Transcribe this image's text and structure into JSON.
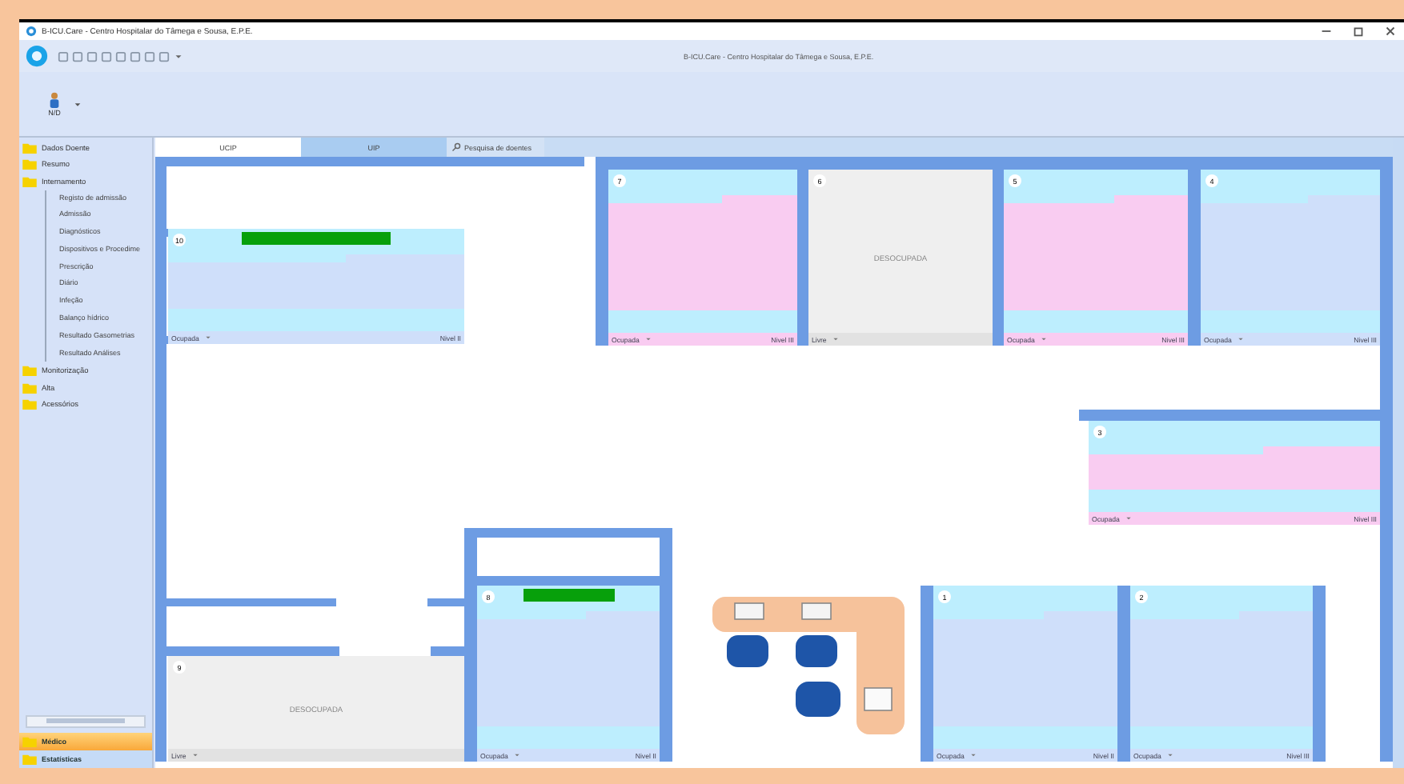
{
  "window": {
    "title": "B-ICU.Care - Centro Hospitalar do Tâmega e Sousa, E.P.E.",
    "ribbon_title": "B-ICU.Care - Centro Hospitalar do Tâmega e Sousa, E.P.E."
  },
  "user": {
    "label": "N/D"
  },
  "sidebar": {
    "items": [
      {
        "label": "Dados Doente"
      },
      {
        "label": "Resumo"
      },
      {
        "label": "Internamento",
        "children": [
          {
            "label": "Registo de admissão"
          },
          {
            "label": "Admissão"
          },
          {
            "label": "Diagnósticos"
          },
          {
            "label": "Dispositivos e Procedime"
          },
          {
            "label": "Prescrição"
          },
          {
            "label": "Diário"
          },
          {
            "label": "Infeção"
          },
          {
            "label": "Balanço hídrico"
          },
          {
            "label": "Resultado Gasometrias"
          },
          {
            "label": "Resultado Análises"
          }
        ]
      },
      {
        "label": "Monitorização"
      },
      {
        "label": "Alta"
      },
      {
        "label": "Acessórios"
      }
    ],
    "sections": [
      {
        "label": "Médico",
        "selected": true
      },
      {
        "label": "Estatísticas",
        "selected": false
      }
    ]
  },
  "tabs": [
    {
      "label": "UCIP",
      "selected": true
    },
    {
      "label": "UIP",
      "selected": false
    },
    {
      "label": "Pesquisa de doentes",
      "selected": false
    }
  ],
  "beds": [
    {
      "number": "10",
      "kind": "occupied",
      "status": "Ocupada",
      "care_level": "Nivel II",
      "color": "#cfdffa",
      "alert": true
    },
    {
      "number": "7",
      "kind": "occupied",
      "status": "Ocupada",
      "care_level": "Nivel III",
      "color": "#f9ccf1",
      "alert": false
    },
    {
      "number": "6",
      "kind": "free",
      "status": "Livre",
      "note": "DESOCUPADA",
      "color": "#efefef"
    },
    {
      "number": "5",
      "kind": "occupied",
      "status": "Ocupada",
      "care_level": "Nivel III",
      "color": "#f9ccf1",
      "alert": false
    },
    {
      "number": "4",
      "kind": "occupied",
      "status": "Ocupada",
      "care_level": "Nivel III",
      "color": "#cfdffa",
      "alert": false
    },
    {
      "number": "3",
      "kind": "occupied",
      "status": "Ocupada",
      "care_level": "Nivel III",
      "color": "#f9ccf1",
      "alert": false
    },
    {
      "number": "9",
      "kind": "free",
      "status": "Livre",
      "note": "DESOCUPADA",
      "color": "#efefef"
    },
    {
      "number": "8",
      "kind": "occupied",
      "status": "Ocupada",
      "care_level": "Nivel II",
      "color": "#cfdffa",
      "alert": true
    },
    {
      "number": "1",
      "kind": "occupied",
      "status": "Ocupada",
      "care_level": "Nivel II",
      "color": "#cfdffa",
      "alert": false
    },
    {
      "number": "2",
      "kind": "occupied",
      "status": "Ocupada",
      "care_level": "Nivel III",
      "color": "#cfdffa",
      "alert": false
    }
  ]
}
